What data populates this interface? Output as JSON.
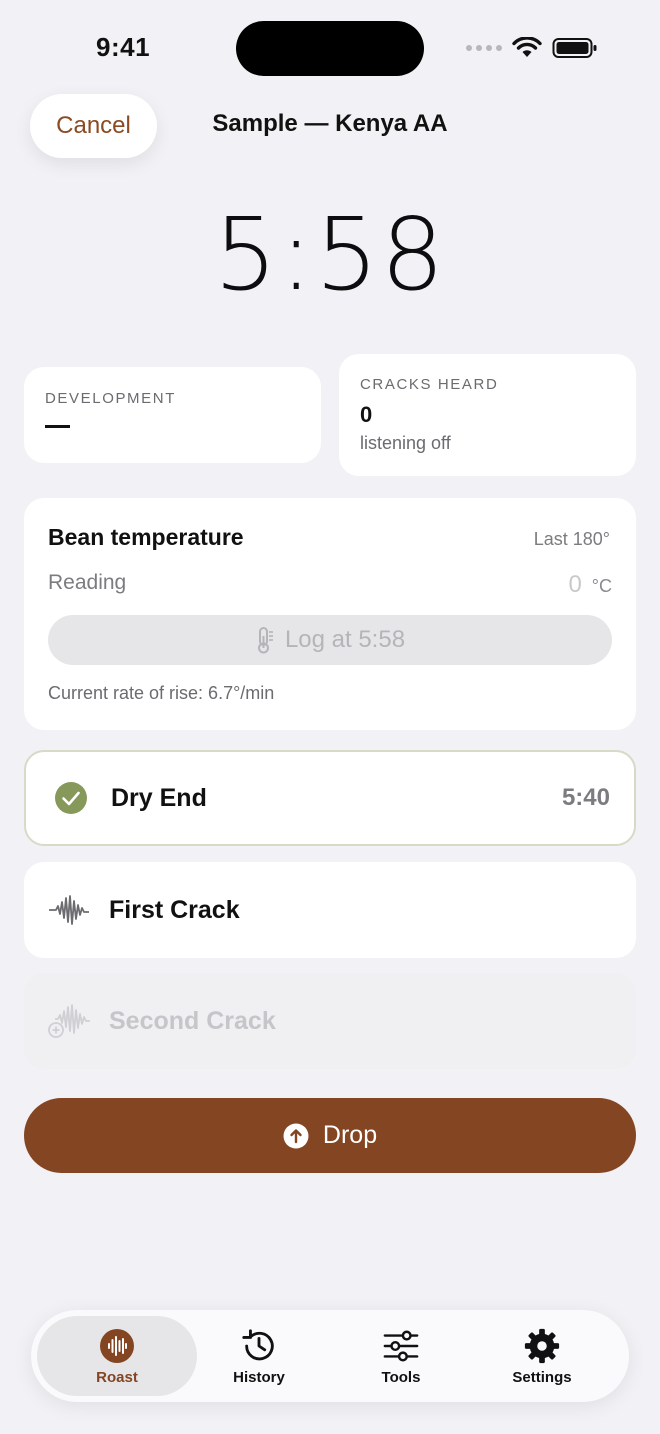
{
  "status_bar": {
    "time": "9:41"
  },
  "header": {
    "cancel_label": "Cancel",
    "title": "Sample — Kenya AA"
  },
  "timer": {
    "value": "5:58"
  },
  "development": {
    "label": "DEVELOPMENT"
  },
  "cracks": {
    "label": "CRACKS HEARD",
    "count": "0",
    "sub": "listening off"
  },
  "bean_temp": {
    "title": "Bean temperature",
    "last": "Last 180°",
    "reading_label": "Reading",
    "reading_value": "0",
    "unit": "°C",
    "log_label": "Log at 5:58",
    "rate": "Current rate of rise: 6.7°/min"
  },
  "events": {
    "dry_end": {
      "label": "Dry End",
      "time": "5:40"
    },
    "first_crack": {
      "label": "First Crack"
    },
    "second_crack": {
      "label": "Second Crack"
    }
  },
  "drop": {
    "label": "Drop"
  },
  "tabs": [
    {
      "label": "Roast",
      "icon": "waveform-icon"
    },
    {
      "label": "History",
      "icon": "history-clock-icon"
    },
    {
      "label": "Tools",
      "icon": "sliders-icon"
    },
    {
      "label": "Settings",
      "icon": "gear-icon"
    }
  ],
  "colors": {
    "accent": "#844522",
    "check": "#86995a",
    "background": "#f2f2f6"
  }
}
